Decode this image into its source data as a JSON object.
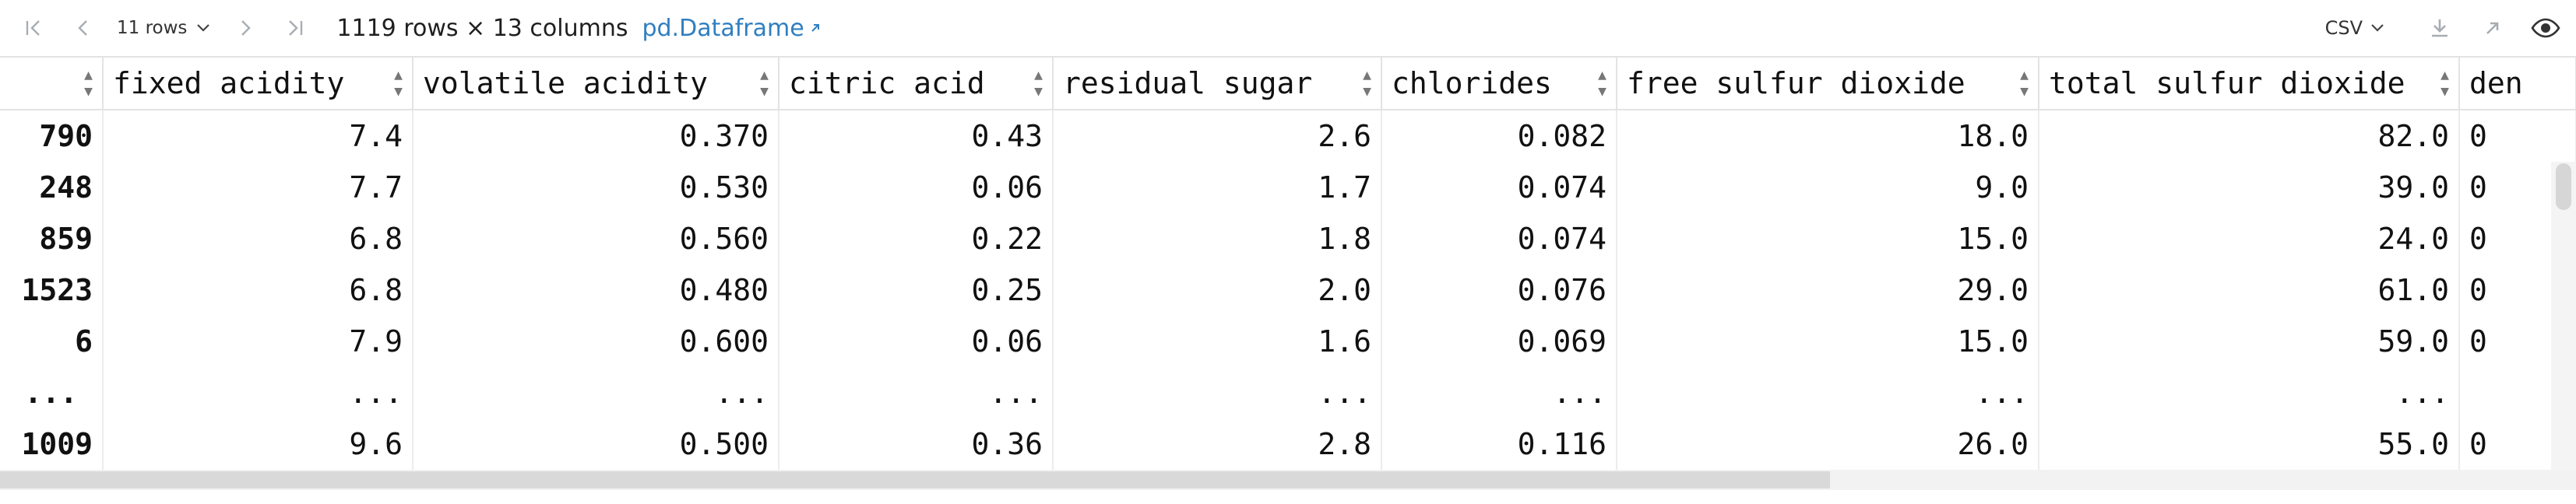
{
  "toolbar": {
    "rows_select": "11 rows",
    "summary": "1119 rows × 13 columns",
    "df_link": "pd.Dataframe",
    "format_select": "CSV"
  },
  "table": {
    "index_header": "",
    "headers": [
      "fixed acidity",
      "volatile acidity",
      "citric acid",
      "residual sugar",
      "chlorides",
      "free sulfur dioxide",
      "total sulfur dioxide",
      "den"
    ],
    "rows": [
      {
        "index": "790",
        "cells": [
          "7.4",
          "0.370",
          "0.43",
          "2.6",
          "0.082",
          "18.0",
          "82.0",
          "0"
        ]
      },
      {
        "index": "248",
        "cells": [
          "7.7",
          "0.530",
          "0.06",
          "1.7",
          "0.074",
          "9.0",
          "39.0",
          "0"
        ]
      },
      {
        "index": "859",
        "cells": [
          "6.8",
          "0.560",
          "0.22",
          "1.8",
          "0.074",
          "15.0",
          "24.0",
          "0"
        ]
      },
      {
        "index": "1523",
        "cells": [
          "6.8",
          "0.480",
          "0.25",
          "2.0",
          "0.076",
          "29.0",
          "61.0",
          "0"
        ]
      },
      {
        "index": "6",
        "cells": [
          "7.9",
          "0.600",
          "0.06",
          "1.6",
          "0.069",
          "15.0",
          "59.0",
          "0"
        ]
      },
      {
        "index": "...",
        "cells": [
          "...",
          "...",
          "...",
          "...",
          "...",
          "...",
          "...",
          ""
        ]
      },
      {
        "index": "1009",
        "cells": [
          "9.6",
          "0.500",
          "0.36",
          "2.8",
          "0.116",
          "26.0",
          "55.0",
          "0"
        ]
      }
    ]
  },
  "colors": {
    "link": "#2f7fc1",
    "icon": "#9aa0a6",
    "grid": "#e3e3e3"
  }
}
